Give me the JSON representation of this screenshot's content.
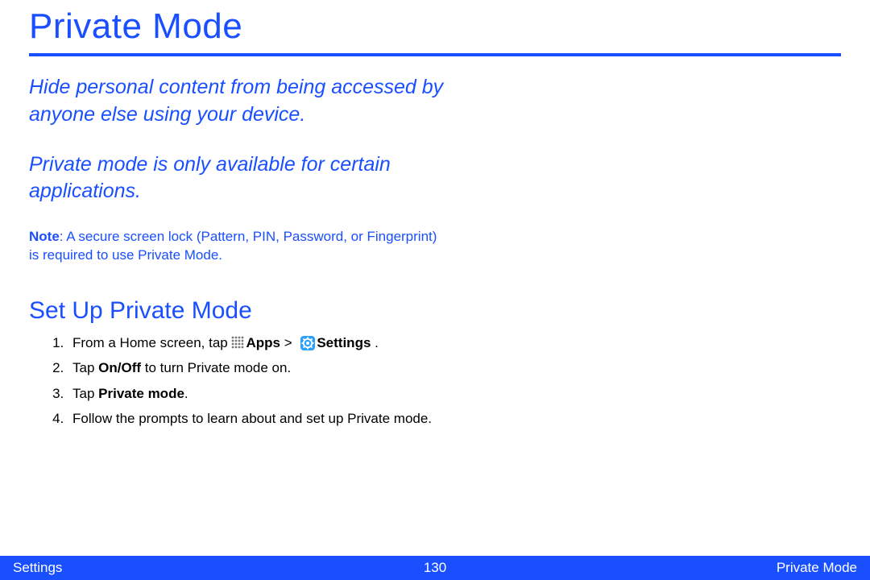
{
  "title": "Private Mode",
  "intro1": "Hide personal content from being accessed by anyone else using your device.",
  "intro2": "Private mode is only available for certain applications.",
  "note_bold": "Note",
  "note_rest": ": A secure screen lock (Pattern, PIN, Password, or Fingerprint) is required to use Private Mode.",
  "section_heading": "Set Up Private Mode",
  "steps": {
    "s1_pre": "From a Home screen, tap ",
    "s1_apps": "Apps",
    "s1_gt": " > ",
    "s1_settings": "Settings",
    "s1_post": " .",
    "s2_pre": "Tap ",
    "s2_bold": "On/Off",
    "s2_post": " to turn Private mode on.",
    "s3_pre": "Tap ",
    "s3_bold": "Private mode",
    "s3_post": ".",
    "s4": "Follow the prompts to learn about and set up Private mode."
  },
  "footer": {
    "left": "Settings",
    "center": "130",
    "right": "Private Mode"
  }
}
